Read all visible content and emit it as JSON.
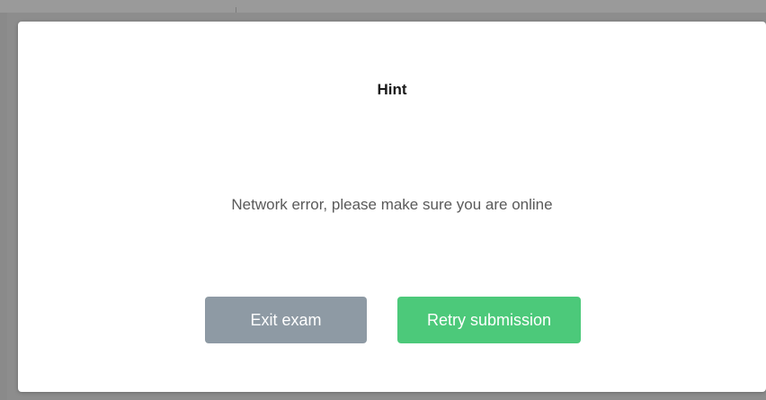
{
  "dialog": {
    "title": "Hint",
    "message": "Network error, please make sure you are online",
    "buttons": {
      "exit_label": "Exit exam",
      "retry_label": "Retry submission"
    }
  },
  "colors": {
    "exit_button": "#8e9aa4",
    "retry_button": "#4cc97a",
    "dialog_background": "#ffffff",
    "backdrop": "#8d8d8d"
  }
}
